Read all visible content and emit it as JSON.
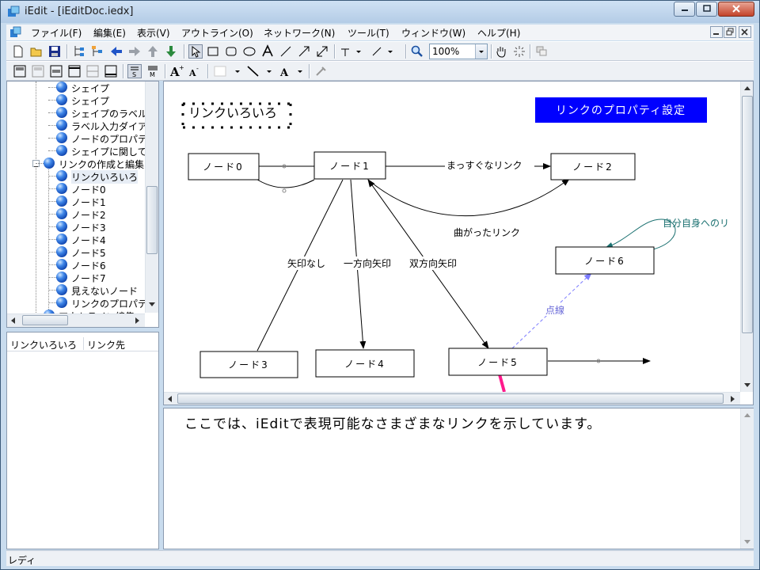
{
  "window": {
    "title": "iEdit - [iEditDoc.iedx]"
  },
  "menu": [
    "ファイル(F)",
    "編集(E)",
    "表示(V)",
    "アウトライン(O)",
    "ネットワーク(N)",
    "ツール(T)",
    "ウィンドウ(W)",
    "ヘルプ(H)"
  ],
  "toolbar": {
    "zoom": "100%"
  },
  "tree": {
    "items": [
      {
        "label": "シェイプ",
        "icon": "node-ball-icon"
      },
      {
        "label": "シェイプ",
        "icon": "node-ball-icon"
      },
      {
        "label": "シェイプのラベル",
        "icon": "node-ball-icon"
      },
      {
        "label": "ラベル入力ダイア",
        "icon": "node-ball-icon"
      },
      {
        "label": "ノードのプロパテ",
        "icon": "node-ball-icon"
      },
      {
        "label": "シェイプに関して",
        "icon": "node-ball-icon"
      },
      {
        "label": "リンクの作成と編集",
        "icon": "node-ball-icon",
        "expanded": true
      },
      {
        "label": "リンクいろいろ",
        "icon": "node-ball-icon",
        "selected": true
      },
      {
        "label": "ノード0",
        "icon": "node-ball-icon"
      },
      {
        "label": "ノード1",
        "icon": "node-ball-icon"
      },
      {
        "label": "ノード2",
        "icon": "node-ball-icon"
      },
      {
        "label": "ノード3",
        "icon": "node-ball-icon"
      },
      {
        "label": "ノード4",
        "icon": "node-ball-icon"
      },
      {
        "label": "ノード5",
        "icon": "node-ball-icon"
      },
      {
        "label": "ノード6",
        "icon": "node-ball-icon"
      },
      {
        "label": "ノード7",
        "icon": "node-ball-icon"
      },
      {
        "label": "見えないノード",
        "icon": "node-ball-icon"
      },
      {
        "label": "リンクのプロパテ",
        "icon": "node-ball-icon"
      },
      {
        "label": "アウトライン編集",
        "icon": "node-ball-icon"
      }
    ]
  },
  "link_list": {
    "columns": [
      "リンクいろいろ",
      "リンク先"
    ]
  },
  "canvas": {
    "selected_title": "リンクいろいろ",
    "property_button": "リンクのプロパティ設定",
    "nodes": [
      "ノード0",
      "ノード1",
      "ノード2",
      "ノード3",
      "ノード4",
      "ノード5",
      "ノード6"
    ],
    "links": {
      "straight": "まっすぐなリンク",
      "curved": "曲がったリンク",
      "no_arrow": "矢印なし",
      "one_way": "一方向矢印",
      "two_way": "双方向矢印",
      "dashed": "点線",
      "self": "自分自身へのリ"
    },
    "colors": {
      "property_button_bg": "#0000ff",
      "self_link": "#1f8a8a",
      "dashed_link": "#8a8af0",
      "selection_mark": "#ff1a8c"
    }
  },
  "note": {
    "text": "ここでは、iEditで表現可能なさまざまなリンクを示しています。"
  },
  "status": {
    "text": "レディ"
  }
}
